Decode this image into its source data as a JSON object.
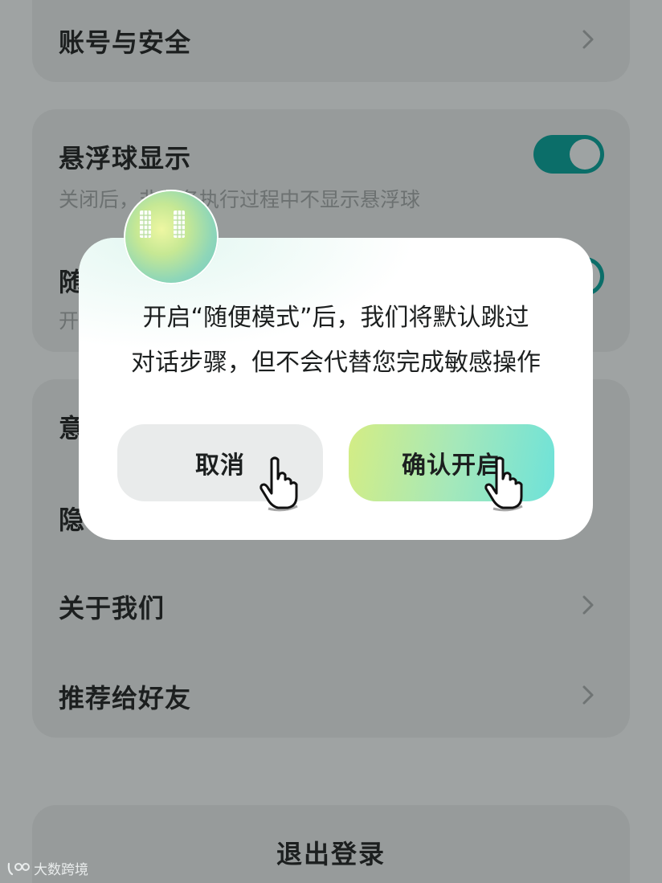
{
  "settings": {
    "account_security": "账号与安全",
    "float_ball": {
      "title": "悬浮球显示",
      "subtitle": "关闭后，非任务执行过程中不显示悬浮球",
      "enabled": true
    },
    "casual_mode": {
      "title_partial": "随",
      "subtitle_partial": "开",
      "enabled": true
    },
    "hidden_row_1_partial": "意",
    "hidden_row_2_partial": "隐",
    "about_us": "关于我们",
    "recommend": "推荐给好友",
    "logout": "退出登录"
  },
  "dialog": {
    "line1": "开启“随便模式”后，我们将默认跳过",
    "line2": "对话步骤，但不会代替您完成敏感操作",
    "cancel_label": "取消",
    "confirm_label": "确认开启"
  },
  "watermark": {
    "text": "大数跨境"
  },
  "colors": {
    "overlay_bg": "#9fa3a3",
    "toggle_on": "#0b6e69",
    "confirm_gradient_start": "#d4ed84",
    "confirm_gradient_end": "#6ee2d9"
  }
}
